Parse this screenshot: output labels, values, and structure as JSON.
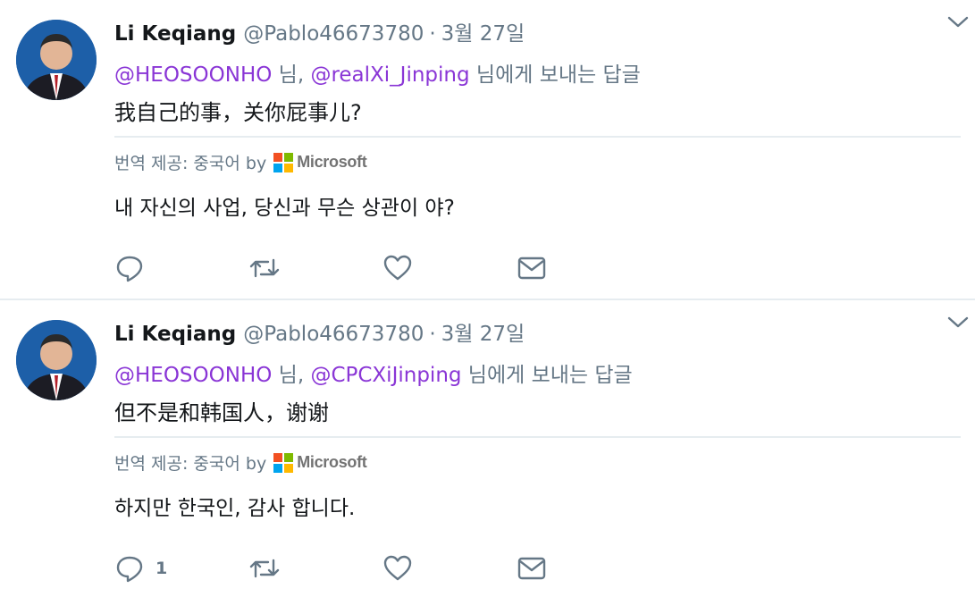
{
  "tweets": [
    {
      "author_name": "Li Keqiang",
      "handle": "@Pablo46673780",
      "dot": "·",
      "date": "3월 27일",
      "reply_mention_1": "@HEOSOONHO",
      "reply_sep": " 님, ",
      "reply_mention_2": "@realXi_Jinping",
      "reply_suffix": " 님에게 보내는 답글",
      "text": "我自己的事，关你屁事儿?",
      "translation_label": "번역 제공: 중국어 by",
      "translator": "Microsoft",
      "translation": "내 자신의 사업, 당신과 무슨 상관이 야?",
      "reply_count": ""
    },
    {
      "author_name": "Li Keqiang",
      "handle": "@Pablo46673780",
      "dot": "·",
      "date": "3월 27일",
      "reply_mention_1": "@HEOSOONHO",
      "reply_sep": " 님, ",
      "reply_mention_2": "@CPCXiJinping",
      "reply_suffix": " 님에게 보내는 답글",
      "text": "但不是和韩国人，谢谢",
      "translation_label": "번역 제공: 중국어 by",
      "translator": "Microsoft",
      "translation": "하지만 한국인, 감사 합니다.",
      "reply_count": "1"
    }
  ],
  "colors": {
    "mention": "#8a36d6",
    "secondary_text": "#657786",
    "divider": "#e6ecf0",
    "ms_red": "#f25022",
    "ms_green": "#7fba00",
    "ms_blue": "#00a4ef",
    "ms_yellow": "#ffb900"
  },
  "icons": [
    "chevron-down-icon",
    "reply-icon",
    "retweet-icon",
    "like-icon",
    "direct-message-icon",
    "microsoft-logo-icon"
  ]
}
